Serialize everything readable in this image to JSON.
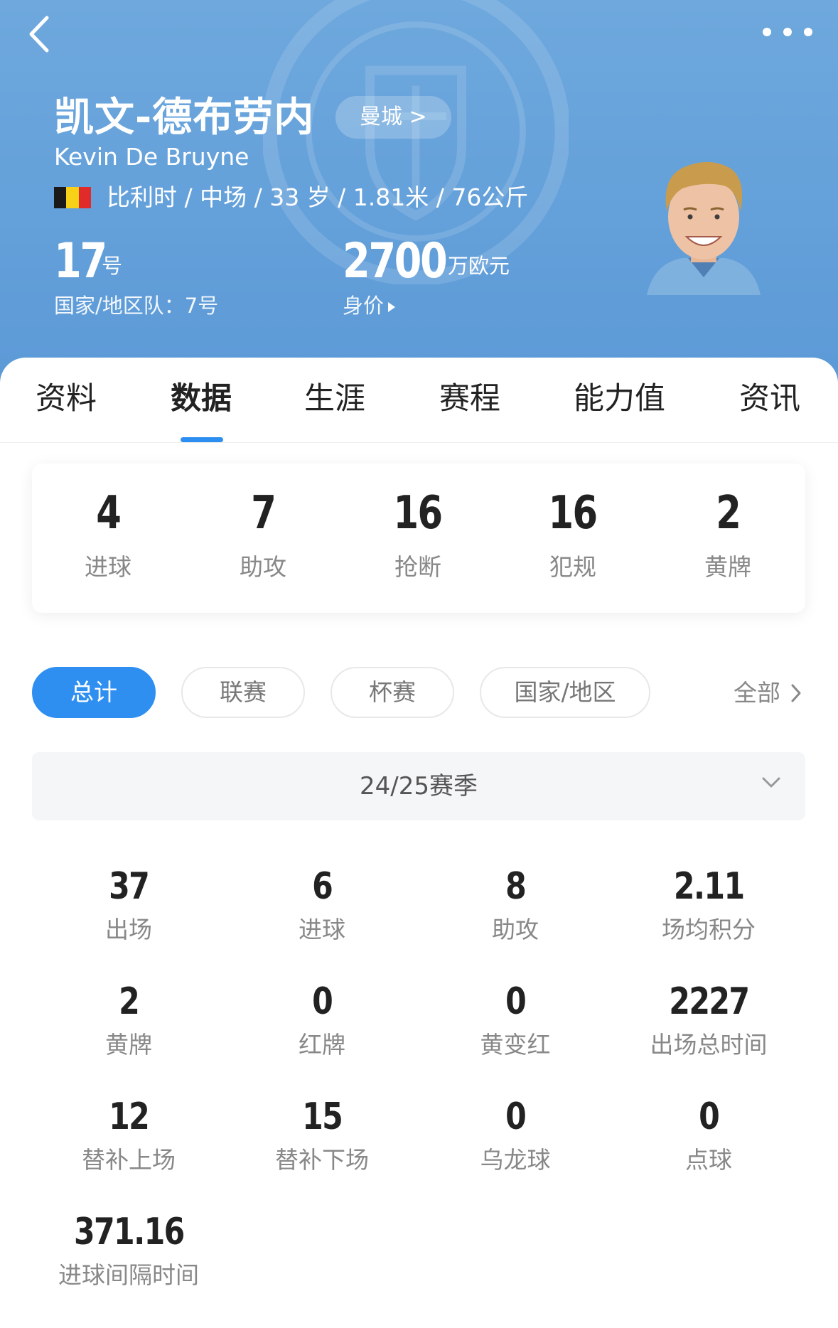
{
  "header": {
    "name_cn": "凯文-德布劳内",
    "name_en": "Kevin De Bruyne",
    "club_link": "曼城 >",
    "bio": "比利时 / 中场 / 33 岁 / 1.81米 / 76公斤",
    "shirt_number": "17",
    "shirt_unit": "号",
    "national_number": "国家/地区队：7号",
    "market_value": "2700",
    "market_value_unit": "万欧元",
    "market_value_label": "身价",
    "flag_colors": [
      "#1a1a1a",
      "#f7d117",
      "#e12a2a"
    ],
    "crest_icon": "manchester-city-crest-watermark"
  },
  "tabs": [
    {
      "label": "资料"
    },
    {
      "label": "数据"
    },
    {
      "label": "生涯"
    },
    {
      "label": "赛程"
    },
    {
      "label": "能力值"
    },
    {
      "label": "资讯"
    }
  ],
  "active_tab": "数据",
  "summary": [
    {
      "value": "4",
      "label": "进球"
    },
    {
      "value": "7",
      "label": "助攻"
    },
    {
      "value": "16",
      "label": "抢断"
    },
    {
      "value": "16",
      "label": "犯规"
    },
    {
      "value": "2",
      "label": "黄牌"
    }
  ],
  "filters": [
    {
      "label": "总计",
      "active": true
    },
    {
      "label": "联赛",
      "active": false
    },
    {
      "label": "杯赛",
      "active": false
    },
    {
      "label": "国家/地区",
      "active": false
    }
  ],
  "filters_all": "全部",
  "season": "24/25赛季",
  "stats": [
    {
      "value": "37",
      "label": "出场"
    },
    {
      "value": "6",
      "label": "进球"
    },
    {
      "value": "8",
      "label": "助攻"
    },
    {
      "value": "2.11",
      "label": "场均积分"
    },
    {
      "value": "2",
      "label": "黄牌"
    },
    {
      "value": "0",
      "label": "红牌"
    },
    {
      "value": "0",
      "label": "黄变红"
    },
    {
      "value": "2227",
      "label": "出场总时间"
    },
    {
      "value": "12",
      "label": "替补上场"
    },
    {
      "value": "15",
      "label": "替补下场"
    },
    {
      "value": "0",
      "label": "乌龙球"
    },
    {
      "value": "0",
      "label": "点球"
    },
    {
      "value": "371.16",
      "label": "进球间隔时间"
    }
  ],
  "colors": {
    "header_bg": "#5c9ad7",
    "accent": "#2f8ff1",
    "text_primary": "#222222",
    "text_secondary": "#888888"
  }
}
